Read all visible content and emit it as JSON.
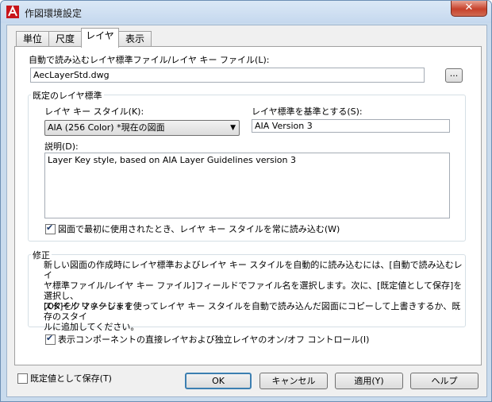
{
  "window": {
    "title": "作図環境設定",
    "close_label": "✕"
  },
  "tabs": [
    {
      "label": "単位"
    },
    {
      "label": "尺度"
    },
    {
      "label": "レイヤ"
    },
    {
      "label": "表示"
    }
  ],
  "layer_tab": {
    "autoload_label": "自動で読み込むレイヤ標準ファイル/レイヤ キー ファイル(L):",
    "autoload_value": "AecLayerStd.dwg",
    "browse_label": "...",
    "default_group_title": "既定のレイヤ標準",
    "key_style_label": "レイヤ キー スタイル(K):",
    "key_style_value": "AIA (256 Color) *現在の図面",
    "based_on_label": "レイヤ標準を基準とする(S):",
    "based_on_value": "AIA Version 3",
    "description_label": "説明(D):",
    "description_value": "Layer Key style, based on AIA Layer Guidelines version 3",
    "always_import_label": "図面で最初に使用されたとき、レイヤ キー スタイルを常に読み込む(W)",
    "always_import_checked": true,
    "modify_group_title": "修正",
    "modify_text_1_line1": "新しい図面の作成時にレイヤ標準およびレイヤ キー スタイルを自動的に読み込むには、[自動で読み込むレイ",
    "modify_text_1_line2": "ヤ標準ファイル/レイヤ キー ファイル]フィールドでファイル名を選択します。次に、[既定値として保存]を選択し、",
    "modify_text_1_line3": "[OK]をクリックします",
    "modify_text_2_line1": "スタイル マネージャを使ってレイヤ キー スタイルを自動で読み込んだ図面にコピーして上書きするか、既存のスタイ",
    "modify_text_2_line2": "ルに追加してください。",
    "direct_layer_label": "表示コンポーネントの直接レイヤおよび独立レイヤのオン/オフ コントロール(I)",
    "direct_layer_checked": true
  },
  "footer": {
    "save_default_label": "既定値として保存(T)",
    "save_default_checked": false,
    "ok_label": "OK",
    "cancel_label": "キャンセル",
    "apply_label": "適用(Y)",
    "help_label": "ヘルプ"
  },
  "colors": {
    "titlebar": "#c9dbed",
    "close": "#c7412b",
    "app_icon": "#c8151b"
  }
}
